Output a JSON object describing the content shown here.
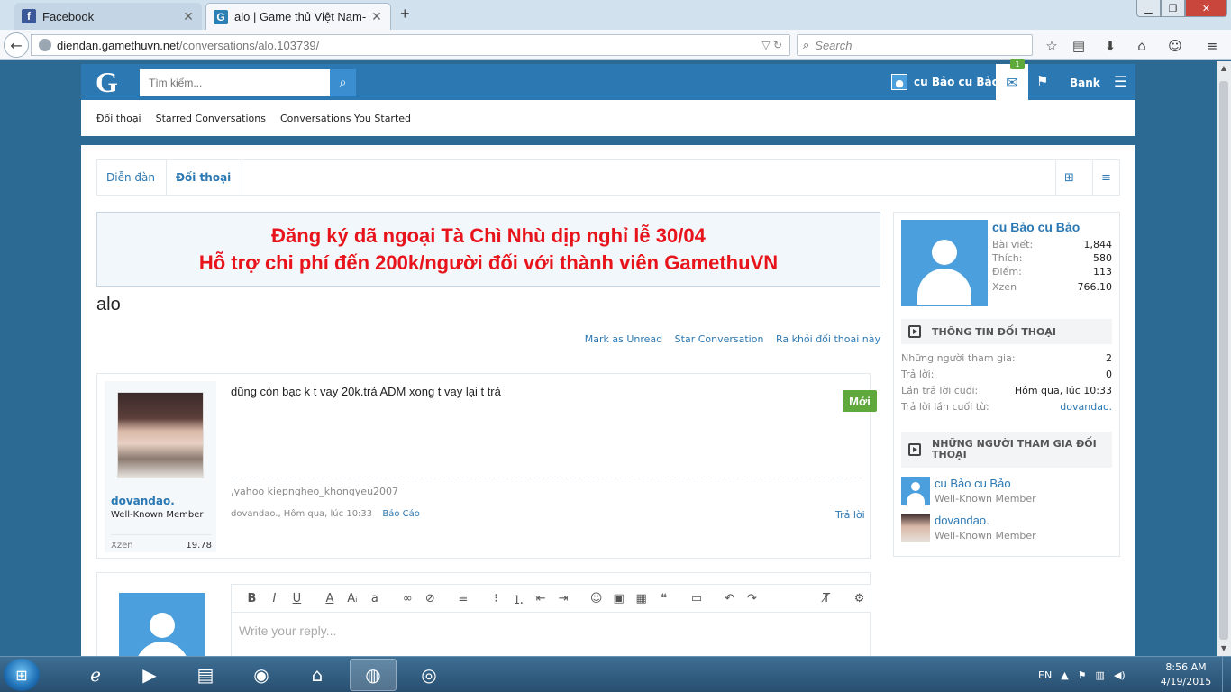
{
  "browser": {
    "tabs": [
      {
        "title": "Facebook",
        "icon": "facebook-icon"
      },
      {
        "title": "alo | Game thủ Việt Nam- ...",
        "icon": "gamethuvn-icon"
      }
    ],
    "url_domain": "diendan.gamethuvn.net",
    "url_path": "/conversations/alo.103739/",
    "search_placeholder": "Search"
  },
  "site": {
    "logo": "G",
    "search_placeholder": "Tìm kiếm...",
    "user_name": "cu Bảo cu Bảo",
    "inbox_badge": "1",
    "bank_label": "Bank",
    "subnav": [
      "Đối thoại",
      "Starred Conversations",
      "Conversations You Started"
    ]
  },
  "breadcrumb": [
    "Diễn đàn",
    "Đối thoại"
  ],
  "banner": {
    "line1": "Đăng ký dã ngoại Tà Chì Nhù dịp nghỉ lễ 30/04",
    "line2": "Hỗ trợ chi phí đến 200k/người đối với thành viên GamethuVN"
  },
  "conversation": {
    "title": "alo",
    "links": [
      "Mark as Unread",
      "Star Conversation",
      "Ra khỏi đối thoại này"
    ]
  },
  "message": {
    "author": "dovandao.",
    "author_title": "Well-Known Member",
    "xzen_label": "Xzen",
    "xzen_value": "19.78",
    "body": "dũng còn bạc k t vay 20k.trả ADM xong t vay lại t trả",
    "new_badge": "Mới",
    "signature": ",yahoo kiepngheo_khongyeu2007",
    "meta": "dovandao., Hôm qua, lúc 10:33",
    "report_label": "Báo Cáo",
    "reply_label": "Trả lời"
  },
  "editor": {
    "placeholder": "Write your reply..."
  },
  "sidebar": {
    "name": "cu Bảo cu Bảo",
    "stats": [
      {
        "k": "Bài viết:",
        "v": "1,844"
      },
      {
        "k": "Thích:",
        "v": "580"
      },
      {
        "k": "Điểm:",
        "v": "113"
      },
      {
        "k": "Xzen",
        "v": "766.10"
      }
    ],
    "info_heading": "THÔNG TIN ĐỐI THOẠI",
    "info": [
      {
        "k": "Những người tham gia:",
        "v": "2"
      },
      {
        "k": "Trả lời:",
        "v": "0"
      },
      {
        "k": "Lần trả lời cuối:",
        "v": "Hôm qua, lúc 10:33"
      },
      {
        "k": "Trả lời lần cuối từ:",
        "v": "dovandao."
      }
    ],
    "participants_heading": "NHỮNG NGƯỜI THAM GIA ĐỐI THOẠI",
    "participants": [
      {
        "name": "cu Bảo cu Bảo",
        "title": "Well-Known Member"
      },
      {
        "name": "dovandao.",
        "title": "Well-Known Member"
      }
    ]
  },
  "taskbar": {
    "lang": "EN",
    "time": "8:56 AM",
    "date": "4/19/2015"
  }
}
